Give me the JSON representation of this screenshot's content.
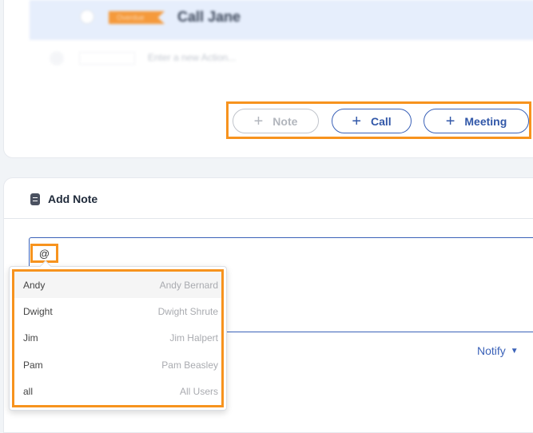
{
  "actions": {
    "task_title": "Call Jane",
    "badge": "Overdue",
    "new_action_placeholder": "Enter a new Action..."
  },
  "buttons": {
    "note": "Note",
    "call": "Call",
    "meeting": "Meeting",
    "plus": "+"
  },
  "add_note": {
    "title": "Add Note",
    "input_value": "@",
    "notify": "Notify",
    "notify_caret": "▼"
  },
  "mentions": [
    {
      "handle": "Andy",
      "name": "Andy Bernard"
    },
    {
      "handle": "Dwight",
      "name": "Dwight Shrute"
    },
    {
      "handle": "Jim",
      "name": "Jim Halpert"
    },
    {
      "handle": "Pam",
      "name": "Pam Beasley"
    },
    {
      "handle": "all",
      "name": "All Users"
    }
  ]
}
